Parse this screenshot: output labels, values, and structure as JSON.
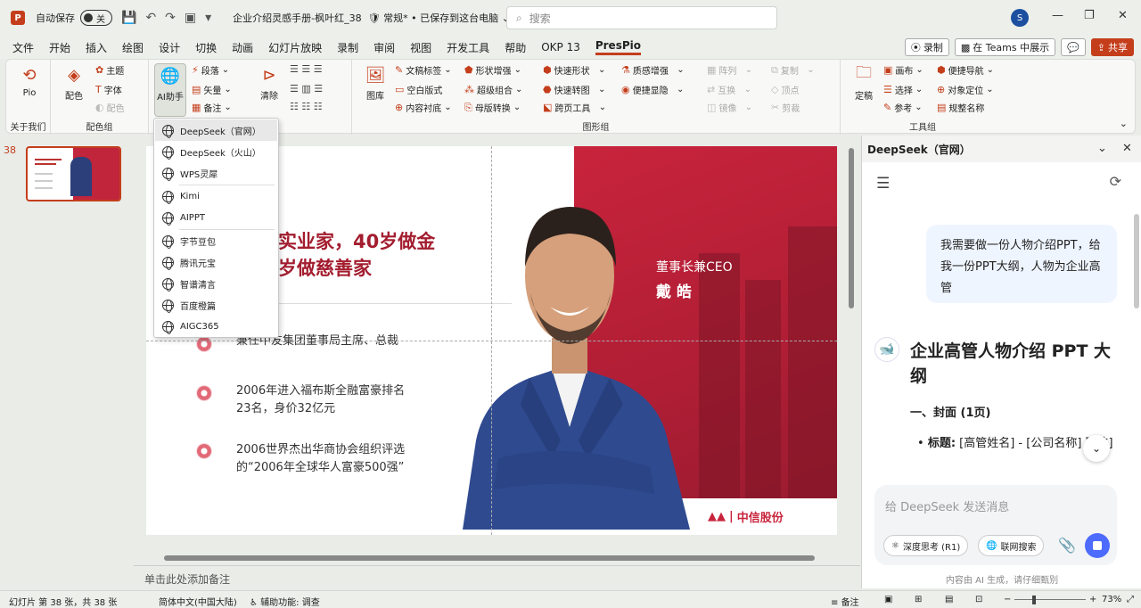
{
  "titlebar": {
    "app_letter": "P",
    "autosave_label": "自动保存",
    "autosave_state": "关",
    "doc_title": "企业介绍灵感手册-枫叶红_38",
    "sensitivity": "常规*",
    "save_status": "已保存到这台电脑",
    "search_placeholder": "搜索",
    "avatar_letter": "S"
  },
  "menu": {
    "tabs": [
      "文件",
      "开始",
      "插入",
      "绘图",
      "设计",
      "切换",
      "动画",
      "幻灯片放映",
      "录制",
      "审阅",
      "视图",
      "开发工具",
      "帮助",
      "OKP 13",
      "PresPio"
    ],
    "active_tab": "PresPio",
    "record_label": "录制",
    "teams_label": "在 Teams 中展示",
    "share_label": "共享"
  },
  "ribbon": {
    "pio_label": "Pio",
    "about_group": "关于我们",
    "color_group": "配色组",
    "peise": "配色",
    "theme": "主题",
    "font": "字体",
    "peise_sm": "配色",
    "ai_label": "AI助手",
    "paragraph": "段落",
    "vector": "矢量",
    "backup": "备注",
    "clear": "清除",
    "library": "图库",
    "text_label": "文稿标签",
    "shape_enh": "形状增强",
    "quick_shape": "快速形状",
    "texture": "质感增强",
    "blank": "空白版式",
    "super_combine": "超级组合",
    "quick_convert": "快速转图",
    "easy_show": "便捷显隐",
    "content_bottom": "内容衬底",
    "master_convert": "母版转换",
    "cross_page": "跨页工具",
    "graphic_group": "图形组",
    "array": "阵列",
    "copy": "复制",
    "swap": "互换",
    "vertex": "顶点",
    "mirror": "镜像",
    "cut": "剪裁",
    "finalize": "定稿",
    "canvas": "画布",
    "quick_nav": "便捷导航",
    "select": "选择",
    "obj_locate": "对象定位",
    "ref": "参考",
    "normalize_name": "规整名称",
    "tool_group": "工具组"
  },
  "ai_menu": {
    "items": [
      "DeepSeek（官网）",
      "DeepSeek（火山）",
      "WPS灵犀",
      "Kimi",
      "AIPPT",
      "字节豆包",
      "腾讯元宝",
      "智谱清言",
      "百度橙篇",
      "AIGC365"
    ]
  },
  "thumbs": {
    "slide_number": "38"
  },
  "slide": {
    "heading_line1": "实业家，40岁做金",
    "heading_line2": "岁做慈善家",
    "bullets": [
      "兼任中友集团董事局主席、总裁",
      "2006年进入福布斯全融富豪排名",
      "23名，身价32亿元",
      "2006世界杰出华商协会组织评选",
      "的“2006年全球华人富豪500强”"
    ],
    "ceo_title": "董事长兼CEO",
    "ceo_name": "戴 皓",
    "logo_text": "中信股份"
  },
  "notes": {
    "placeholder": "单击此处添加备注"
  },
  "panel": {
    "title": "DeepSeek（官网）",
    "user_message": "我需要做一份人物介绍PPT，给我一份PPT大纲，人物为企业高管",
    "ai_title": "企业高管人物介绍 PPT 大纲",
    "ai_section": "一、封面 (1页)",
    "ai_item_label": "标题:",
    "ai_item_text": " [高管姓名] - [公司名称] 职位]",
    "composer_placeholder": "给 DeepSeek 发送消息",
    "chip_deep": "深度思考 (R1)",
    "chip_search": "联网搜索",
    "disclaimer": "内容由 AI 生成，请仔细甄别"
  },
  "statusbar": {
    "slide_info": "幻灯片 第 38 张，共 38 张",
    "language": "简体中文(中国大陆)",
    "accessibility": "辅助功能: 调查",
    "notes": "备注",
    "zoom": "73%"
  }
}
